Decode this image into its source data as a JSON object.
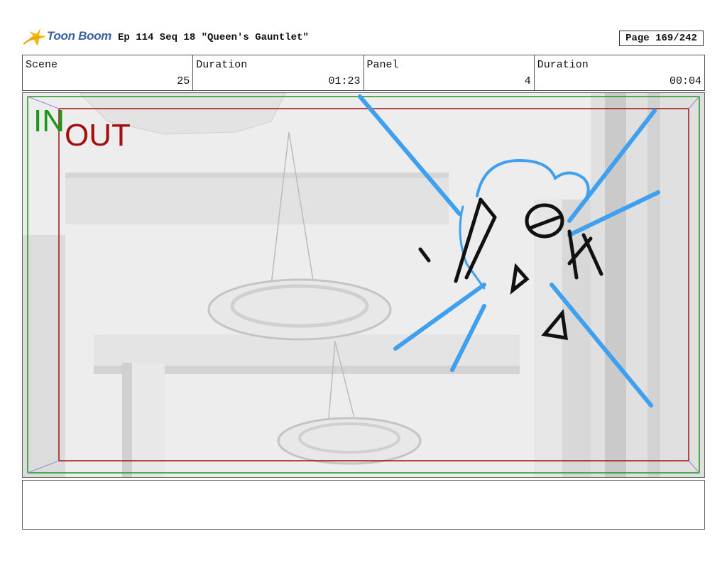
{
  "header": {
    "brand": "Toon Boom",
    "title": "Ep 114 Seq 18 \"Queen's Gauntlet\"",
    "page": "Page 169/242"
  },
  "info": [
    {
      "label": "Scene",
      "value": "25"
    },
    {
      "label": "Duration",
      "value": "01:23"
    },
    {
      "label": "Panel",
      "value": "4"
    },
    {
      "label": "Duration",
      "value": "00:04"
    }
  ],
  "panel": {
    "in_label": "IN",
    "out_label": "OUT",
    "colors": {
      "in_frame": "#1a9a1a",
      "out_frame": "#a31010",
      "effect_lines": "#3ea0ee",
      "sketch_ink": "#111111"
    }
  },
  "notes": {
    "text": ""
  }
}
